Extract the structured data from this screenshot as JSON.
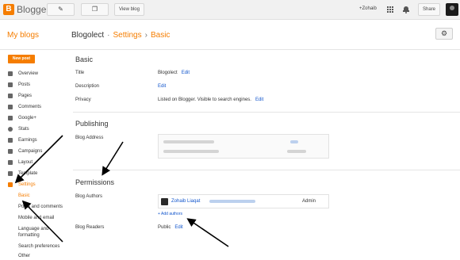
{
  "app": {
    "logo_letter": "B",
    "title": "Blogger"
  },
  "toolbar": {
    "pencil_glyph": "✎",
    "copy_glyph": "❐",
    "view_blog_label": "View blog",
    "user_label": "+Zohaib",
    "share_label": "Share",
    "settings_glyph": "⚙"
  },
  "header": {
    "my_blogs": "My blogs",
    "blog_name": "Blogolect",
    "separator": "·",
    "section": "Settings",
    "chevron": "›",
    "page": "Basic"
  },
  "new_post_label": "New post",
  "sidebar": {
    "items": [
      {
        "label": "Overview",
        "icon": "home-icon"
      },
      {
        "label": "Posts",
        "icon": "posts-icon"
      },
      {
        "label": "Pages",
        "icon": "pages-icon"
      },
      {
        "label": "Comments",
        "icon": "comments-icon"
      },
      {
        "label": "Google+",
        "icon": "google-plus-icon"
      },
      {
        "label": "Stats",
        "icon": "stats-icon"
      },
      {
        "label": "Earnings",
        "icon": "earnings-icon"
      },
      {
        "label": "Campaigns",
        "icon": "campaigns-icon"
      },
      {
        "label": "Layout",
        "icon": "layout-icon"
      },
      {
        "label": "Template",
        "icon": "template-icon"
      },
      {
        "label": "Settings",
        "icon": "wrench-icon"
      }
    ],
    "settings_subitems": [
      {
        "label": "Basic"
      },
      {
        "label": "Posts and comments"
      },
      {
        "label": "Mobile and email"
      },
      {
        "label": "Language and"
      },
      {
        "label": "formatting"
      },
      {
        "label": "Search preferences"
      },
      {
        "label": "Other"
      }
    ]
  },
  "basic": {
    "heading": "Basic",
    "title_label": "Title",
    "title_value": "Blogolect",
    "title_edit": "Edit",
    "description_label": "Description",
    "description_edit": "Edit",
    "privacy_label": "Privacy",
    "privacy_value": "Listed on Blogger. Visible to search engines.",
    "privacy_edit": "Edit"
  },
  "publishing": {
    "heading": "Publishing",
    "blog_address_label": "Blog Address"
  },
  "permissions": {
    "heading": "Permissions",
    "authors_label": "Blog Authors",
    "author_name": "Zohaib Liaqat",
    "author_role": "Admin",
    "add_authors": "+ Add authors",
    "readers_label": "Blog Readers",
    "readers_value": "Public",
    "readers_edit": "Edit"
  },
  "colors": {
    "accent": "#f57d00",
    "link": "#1155cc",
    "annotation_arrows": "#000000"
  }
}
